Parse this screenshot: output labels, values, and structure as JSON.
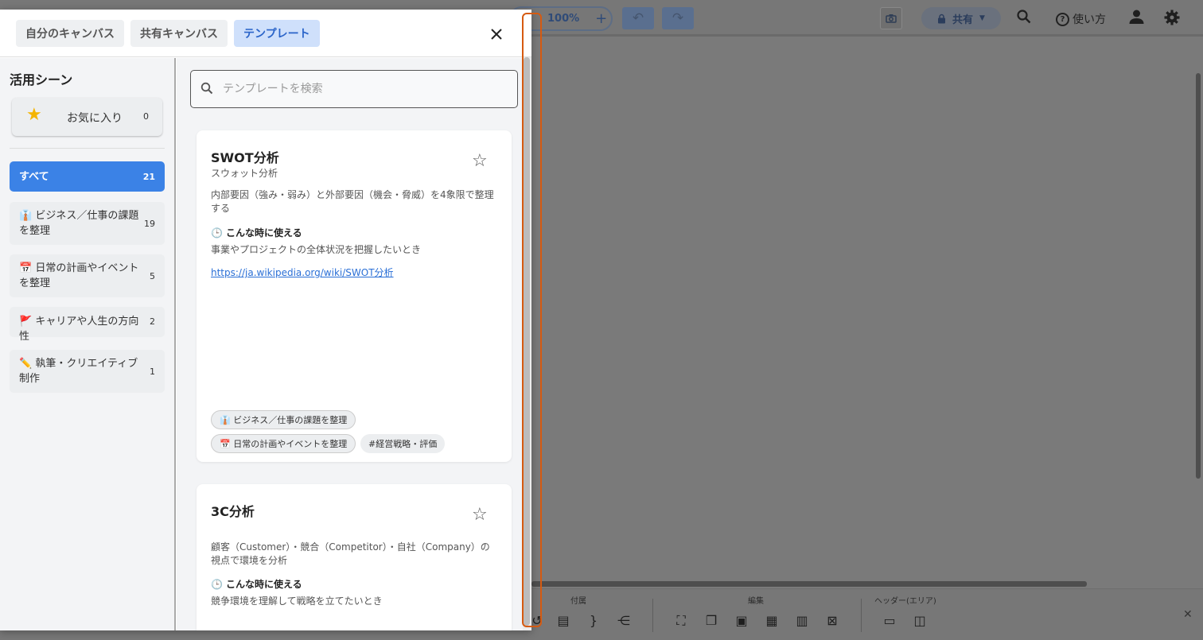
{
  "app": {
    "zoom_label": "100%",
    "zoom_plus": "+",
    "share_label": "共有",
    "help_label": "使い方",
    "bottom_bar": {
      "section_attach": "付属",
      "section_edit": "編集",
      "section_header": "ヘッダー(エリア)"
    }
  },
  "modal": {
    "tabs": [
      {
        "label": "自分のキャンバス"
      },
      {
        "label": "共有キャンバス"
      },
      {
        "label": "テンプレート"
      }
    ],
    "close_label": "×"
  },
  "sidebar": {
    "title": "活用シーン",
    "favorites": {
      "label": "お気に入り",
      "count": "0"
    },
    "categories": [
      {
        "label": "すべて",
        "count": "21"
      },
      {
        "label": "👔 ビジネス／仕事の課題を整理",
        "count": "19"
      },
      {
        "label": "📅 日常の計画やイベントを整理",
        "count": "5"
      },
      {
        "label": "🚩 キャリアや人生の方向性",
        "count": "2"
      },
      {
        "label": "✏️ 執筆・クリエイティブ制作",
        "count": "1"
      }
    ]
  },
  "search": {
    "placeholder": "テンプレートを検索",
    "value": ""
  },
  "templates": [
    {
      "title": "SWOT分析",
      "subtitle": "スウォット分析",
      "description": "内部要因（強み・弱み）と外部要因（機会・脅威）を4象限で整理する",
      "when_label": "こんな時に使える",
      "when_text": "事業やプロジェクトの全体状況を把握したいとき",
      "link": "https://ja.wikipedia.org/wiki/SWOT分析",
      "tags": [
        "👔 ビジネス／仕事の課題を整理",
        "📅 日常の計画やイベントを整理",
        "#経営戦略・評価"
      ]
    },
    {
      "title": "3C分析",
      "description": "顧客（Customer）・競合（Competitor）・自社（Company）の視点で環境を分析",
      "when_label": "こんな時に使える",
      "when_text": "競争環境を理解して戦略を立てたいとき"
    }
  ],
  "colors": {
    "accent": "#3b82e6",
    "active_tab_bg": "#cfe0fb",
    "highlight": "#d65a10",
    "star": "#f4b400"
  }
}
